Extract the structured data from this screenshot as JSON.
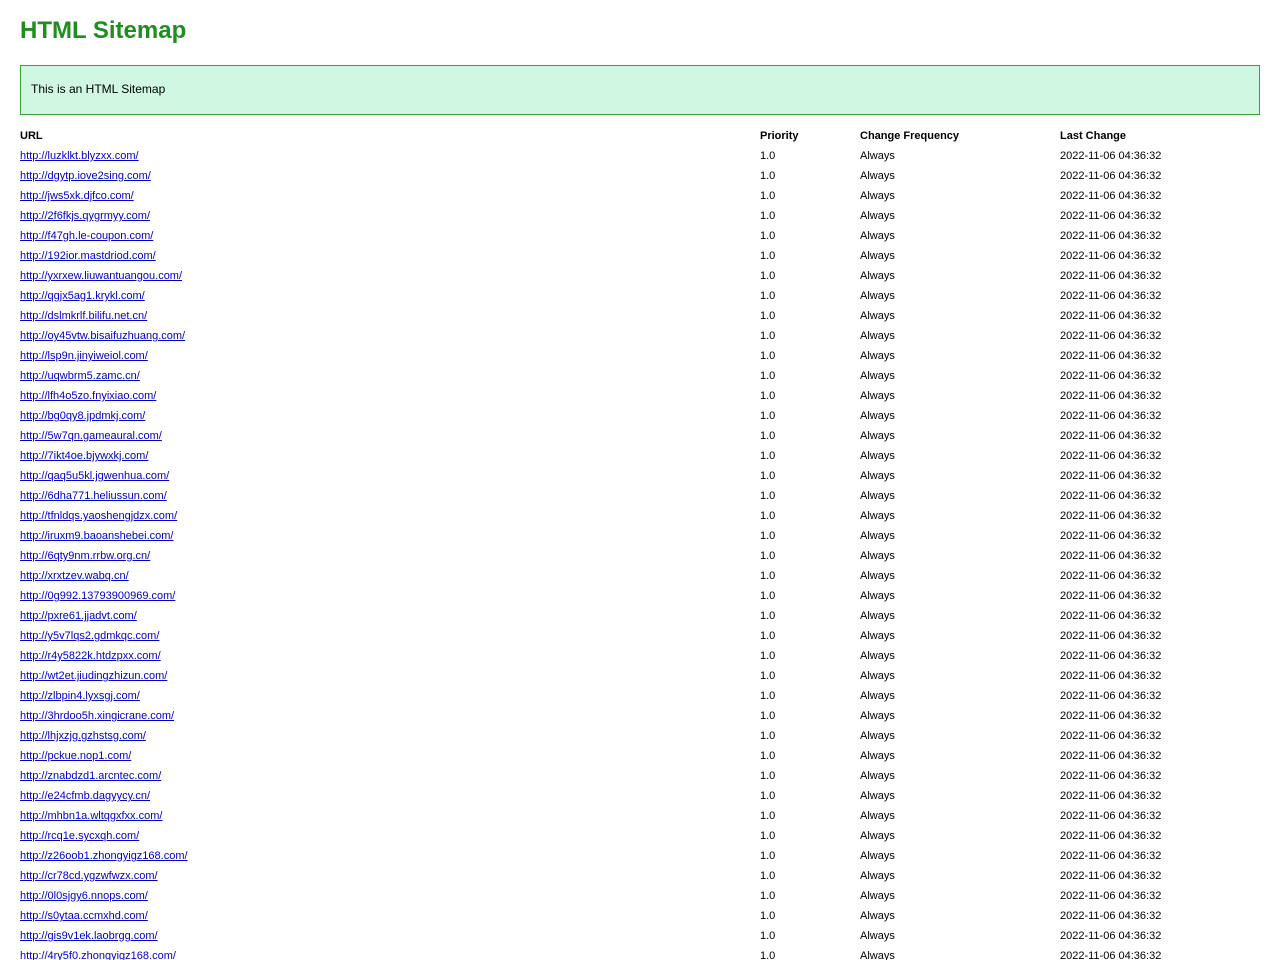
{
  "header": {
    "title": "HTML Sitemap"
  },
  "intro": {
    "text": "This is an HTML Sitemap"
  },
  "table": {
    "columns": [
      "URL",
      "Priority",
      "Change Frequency",
      "Last Change"
    ],
    "rows": [
      {
        "url": "http://luzklkt.blyzxx.com/",
        "priority": "1.0",
        "freq": "Always",
        "last": "2022-11-06 04:36:32"
      },
      {
        "url": "http://dgytp.iove2sing.com/",
        "priority": "1.0",
        "freq": "Always",
        "last": "2022-11-06 04:36:32"
      },
      {
        "url": "http://jws5xk.djfco.com/",
        "priority": "1.0",
        "freq": "Always",
        "last": "2022-11-06 04:36:32"
      },
      {
        "url": "http://2f6fkjs.qygrmyy.com/",
        "priority": "1.0",
        "freq": "Always",
        "last": "2022-11-06 04:36:32"
      },
      {
        "url": "http://f47gh.le-coupon.com/",
        "priority": "1.0",
        "freq": "Always",
        "last": "2022-11-06 04:36:32"
      },
      {
        "url": "http://192ior.mastdriod.com/",
        "priority": "1.0",
        "freq": "Always",
        "last": "2022-11-06 04:36:32"
      },
      {
        "url": "http://yxrxew.liuwantuangou.com/",
        "priority": "1.0",
        "freq": "Always",
        "last": "2022-11-06 04:36:32"
      },
      {
        "url": "http://qgjx5ag1.krykl.com/",
        "priority": "1.0",
        "freq": "Always",
        "last": "2022-11-06 04:36:32"
      },
      {
        "url": "http://dslmkrlf.bilifu.net.cn/",
        "priority": "1.0",
        "freq": "Always",
        "last": "2022-11-06 04:36:32"
      },
      {
        "url": "http://oy45vtw.bisaifuzhuang.com/",
        "priority": "1.0",
        "freq": "Always",
        "last": "2022-11-06 04:36:32"
      },
      {
        "url": "http://lsp9n.jinyiweiol.com/",
        "priority": "1.0",
        "freq": "Always",
        "last": "2022-11-06 04:36:32"
      },
      {
        "url": "http://uqwbrm5.zamc.cn/",
        "priority": "1.0",
        "freq": "Always",
        "last": "2022-11-06 04:36:32"
      },
      {
        "url": "http://lfh4o5zo.fnyixiao.com/",
        "priority": "1.0",
        "freq": "Always",
        "last": "2022-11-06 04:36:32"
      },
      {
        "url": "http://bg0qy8.jpdmkj.com/",
        "priority": "1.0",
        "freq": "Always",
        "last": "2022-11-06 04:36:32"
      },
      {
        "url": "http://5w7qn.gameaural.com/",
        "priority": "1.0",
        "freq": "Always",
        "last": "2022-11-06 04:36:32"
      },
      {
        "url": "http://7ikt4oe.bjywxkj.com/",
        "priority": "1.0",
        "freq": "Always",
        "last": "2022-11-06 04:36:32"
      },
      {
        "url": "http://qaq5u5kl.jgwenhua.com/",
        "priority": "1.0",
        "freq": "Always",
        "last": "2022-11-06 04:36:32"
      },
      {
        "url": "http://6dha771.heliussun.com/",
        "priority": "1.0",
        "freq": "Always",
        "last": "2022-11-06 04:36:32"
      },
      {
        "url": "http://tfnldqs.yaoshengjdzx.com/",
        "priority": "1.0",
        "freq": "Always",
        "last": "2022-11-06 04:36:32"
      },
      {
        "url": "http://iruxm9.baoanshebei.com/",
        "priority": "1.0",
        "freq": "Always",
        "last": "2022-11-06 04:36:32"
      },
      {
        "url": "http://6qty9nm.rrbw.org.cn/",
        "priority": "1.0",
        "freq": "Always",
        "last": "2022-11-06 04:36:32"
      },
      {
        "url": "http://xrxtzev.wabq.cn/",
        "priority": "1.0",
        "freq": "Always",
        "last": "2022-11-06 04:36:32"
      },
      {
        "url": "http://0g992.13793900969.com/",
        "priority": "1.0",
        "freq": "Always",
        "last": "2022-11-06 04:36:32"
      },
      {
        "url": "http://pxre61.jjadvt.com/",
        "priority": "1.0",
        "freq": "Always",
        "last": "2022-11-06 04:36:32"
      },
      {
        "url": "http://y5v7lqs2.gdmkqc.com/",
        "priority": "1.0",
        "freq": "Always",
        "last": "2022-11-06 04:36:32"
      },
      {
        "url": "http://r4y5822k.htdzpxx.com/",
        "priority": "1.0",
        "freq": "Always",
        "last": "2022-11-06 04:36:32"
      },
      {
        "url": "http://wt2et.jiudingzhizun.com/",
        "priority": "1.0",
        "freq": "Always",
        "last": "2022-11-06 04:36:32"
      },
      {
        "url": "http://zlbpin4.lyxsgj.com/",
        "priority": "1.0",
        "freq": "Always",
        "last": "2022-11-06 04:36:32"
      },
      {
        "url": "http://3hrdoo5h.xingicrane.com/",
        "priority": "1.0",
        "freq": "Always",
        "last": "2022-11-06 04:36:32"
      },
      {
        "url": "http://lhjxzjg.gzhstsg.com/",
        "priority": "1.0",
        "freq": "Always",
        "last": "2022-11-06 04:36:32"
      },
      {
        "url": "http://pckue.nop1.com/",
        "priority": "1.0",
        "freq": "Always",
        "last": "2022-11-06 04:36:32"
      },
      {
        "url": "http://znabdzd1.arcntec.com/",
        "priority": "1.0",
        "freq": "Always",
        "last": "2022-11-06 04:36:32"
      },
      {
        "url": "http://e24cfmb.dagyycy.cn/",
        "priority": "1.0",
        "freq": "Always",
        "last": "2022-11-06 04:36:32"
      },
      {
        "url": "http://mhbn1a.wltqgxfxx.com/",
        "priority": "1.0",
        "freq": "Always",
        "last": "2022-11-06 04:36:32"
      },
      {
        "url": "http://rcq1e.sycxqh.com/",
        "priority": "1.0",
        "freq": "Always",
        "last": "2022-11-06 04:36:32"
      },
      {
        "url": "http://z26oob1.zhongyigz168.com/",
        "priority": "1.0",
        "freq": "Always",
        "last": "2022-11-06 04:36:32"
      },
      {
        "url": "http://cr78cd.ygzwfwzx.com/",
        "priority": "1.0",
        "freq": "Always",
        "last": "2022-11-06 04:36:32"
      },
      {
        "url": "http://0l0sjgy6.nnops.com/",
        "priority": "1.0",
        "freq": "Always",
        "last": "2022-11-06 04:36:32"
      },
      {
        "url": "http://s0ytaa.ccmxhd.com/",
        "priority": "1.0",
        "freq": "Always",
        "last": "2022-11-06 04:36:32"
      },
      {
        "url": "http://gis9v1ek.laobrgg.com/",
        "priority": "1.0",
        "freq": "Always",
        "last": "2022-11-06 04:36:32"
      },
      {
        "url": "http://4ry5f0.zhongyigz168.com/",
        "priority": "1.0",
        "freq": "Always",
        "last": "2022-11-06 04:36:32"
      }
    ]
  },
  "colors": {
    "title": "#1e8f1e",
    "intro_background": "#cff7e2",
    "intro_border": "#32a832",
    "link": "#0000cc"
  }
}
